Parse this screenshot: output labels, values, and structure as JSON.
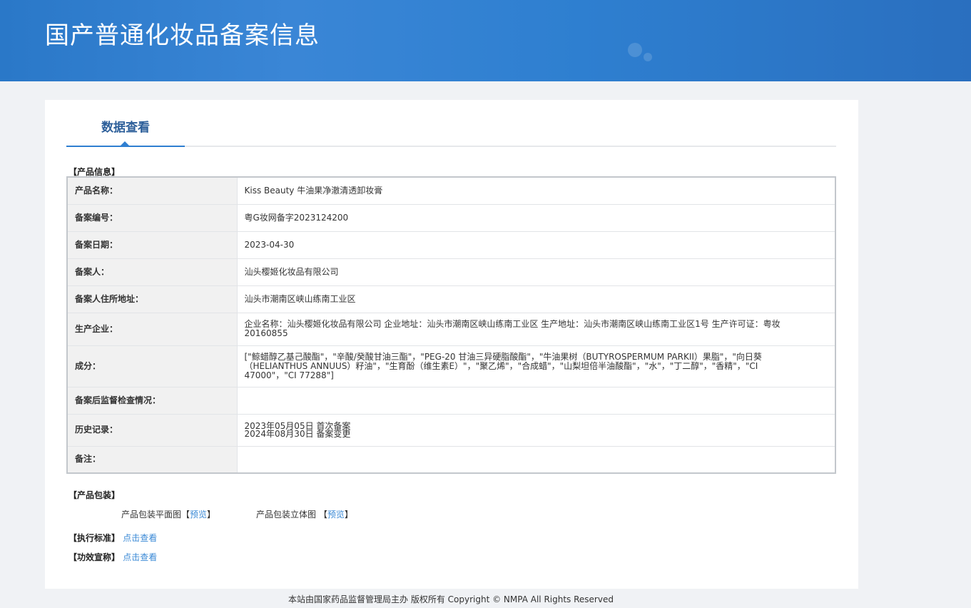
{
  "header": {
    "title": "国产普通化妆品备案信息"
  },
  "tab": {
    "label": "数据查看"
  },
  "product_info": {
    "section": "【产品信息】",
    "rows": [
      {
        "label": "产品名称：",
        "value": "Kiss Beauty 牛油果净澈清透卸妆膏"
      },
      {
        "label": "备案编号：",
        "value": "粤G妆网备字2023124200"
      },
      {
        "label": "备案日期：",
        "value": "2023-04-30"
      },
      {
        "label": "备案人：",
        "value": "汕头樱姬化妆品有限公司"
      },
      {
        "label": "备案人住所地址：",
        "value": "汕头市潮南区峡山练南工业区"
      },
      {
        "label": "生产企业：",
        "value": "企业名称：汕头樱姬化妆品有限公司 企业地址：汕头市潮南区峡山练南工业区 生产地址：汕头市潮南区峡山练南工业区1号 生产许可证：粤妆20160855"
      },
      {
        "label": "成分：",
        "value": "[\"鲸蜡醇乙基己酸酯\"，\"辛酸/癸酸甘油三酯\"，\"PEG-20 甘油三异硬脂酸酯\"，\"牛油果树（BUTYROSPERMUM PARKII）果脂\"，\"向日葵（HELIANTHUS ANNUUS）籽油\"，\"生育酚（维生素E）\"，\"聚乙烯\"，\"合成蜡\"，\"山梨坦倍半油酸酯\"，\"水\"，\"丁二醇\"，\"香精\"，\"CI 47000\"，\"CI 77288\"]"
      },
      {
        "label": "备案后监督检查情况：",
        "value": ""
      },
      {
        "label": "历史记录：",
        "value": "2023年05月05日 首次备案",
        "value2": "2024年08月30日 备案变更"
      },
      {
        "label": "备注：",
        "value": ""
      }
    ]
  },
  "packaging": {
    "section": "【产品包装】",
    "flat_label": "产品包装平面图",
    "flat_link": "预览",
    "solid_label": "产品包装立体图",
    "solid_link": "预览",
    "lb": "【",
    "rb": "】"
  },
  "standard": {
    "label": "【执行标准】",
    "link": "点击查看"
  },
  "claim": {
    "label": "【功效宣称】",
    "link": "点击查看"
  },
  "footer": {
    "text": "本站由国家药品监督管理局主办 版权所有 Copyright © NMPA All Rights Reserved"
  }
}
